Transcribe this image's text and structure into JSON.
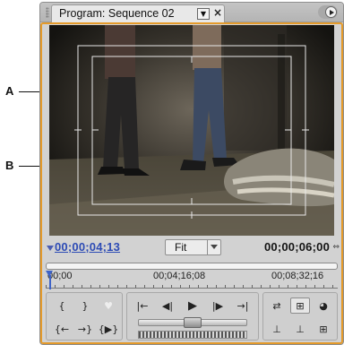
{
  "callouts": {
    "a": "A",
    "b": "B"
  },
  "panel": {
    "tab_title": "Program: Sequence 02",
    "tab_menu_icon": "dropdown-triangle-icon",
    "close_icon": "close-x-icon",
    "panel_menu_icon": "panel-flyout-icon"
  },
  "timecode": {
    "current": "00;00;04;13",
    "zoom": "Fit",
    "duration": "00;00;06;00",
    "duration_icon": "duration-toggle-icon"
  },
  "ruler": {
    "labels": [
      "00;00",
      "00;04;16;08",
      "00;08;32;16"
    ]
  },
  "controls": {
    "marker_buttons": [
      "{",
      "}",
      "♥"
    ],
    "goto_buttons": [
      "{←",
      "→}",
      "{▶}"
    ],
    "transport": [
      "|←",
      "◀|",
      "▶",
      "|▶",
      "→|"
    ],
    "output_buttons": [
      "⇄",
      "⊞",
      "◕"
    ],
    "edit_buttons": [
      "⊥",
      "⊥",
      "⊞"
    ]
  },
  "colors": {
    "accent_frame": "#e49a2a",
    "timecode_blue": "#2d4bb5",
    "playhead_blue": "#3e63c7",
    "panel_bg": "#d2d2d2"
  }
}
